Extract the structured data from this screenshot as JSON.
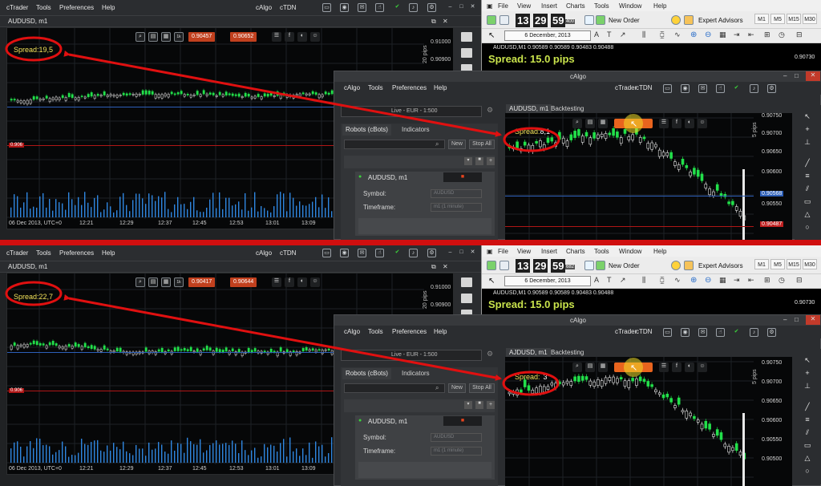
{
  "ctrader": {
    "menu": [
      "cTrader",
      "Tools",
      "Preferences",
      "Help"
    ],
    "right_menu": [
      "cAlgo",
      "cTDN"
    ],
    "symbol": "AUDUSD, m1",
    "price_ticks": [
      "0.91000",
      "0.90900"
    ],
    "time_ticks": [
      "06 Dec 2013, UTC+0",
      "12:21",
      "12:29",
      "12:37",
      "12:45",
      "12:53",
      "13:01",
      "13:09"
    ],
    "pips_label": "20 pips",
    "level_label": "0.906"
  },
  "panels": [
    {
      "spread_label": "Spread:",
      "spread_value": "19,5",
      "sell_price": "0.90457",
      "buy_price": "0.90652",
      "calgo_spread_label": "Spread:",
      "calgo_spread_value": "8,1"
    },
    {
      "spread_label": "Spread:",
      "spread_value": "22,7",
      "sell_price": "0.90417",
      "buy_price": "0.90644",
      "calgo_spread_label": "Spread:",
      "calgo_spread_value": "3"
    }
  ],
  "mt4": {
    "menu": [
      "File",
      "View",
      "Insert",
      "Charts",
      "Tools",
      "Window",
      "Help"
    ],
    "clock": {
      "h": "13",
      "m": "29",
      "s": "59"
    },
    "clock_badges": [
      "400",
      "682"
    ],
    "new_order": "New Order",
    "expert_advisors": "Expert Advisors",
    "timeframes": [
      "M1",
      "M5",
      "M15",
      "M30"
    ],
    "date": "6 December, 2013",
    "quote_line": "AUDUSD,M1 0.90589 0.90589 0.90483 0.90488",
    "quote_line_2": "AUDUSD,M1 0.90589 0.90589 0.90483 0.90488",
    "spread_text": "Spread: 15.0 pips",
    "price_right": "0.90730"
  },
  "calgo": {
    "title": "cAlgo",
    "menu": [
      "cAlgo",
      "Tools",
      "Preferences",
      "Help"
    ],
    "right_menu": [
      "cTrader",
      "cTDN"
    ],
    "account": "Live - EUR - 1:500",
    "tabs_left": [
      "Robots (cBots)",
      "Indicators"
    ],
    "new_label": "New",
    "stop_all_label": "Stop All",
    "instance": "AUDUSD, m1",
    "symbol_label": "Symbol:",
    "symbol_value": "AUDUSD",
    "timeframe_label": "Timeframe:",
    "timeframe_value": "m1 (1 minute)",
    "chart_tab": "AUDUSD, m1",
    "chart_tab_2": "AJDUSD, m1",
    "backtesting": "Backtesting",
    "price_ticks": [
      "0.90750",
      "0.90700",
      "0.90650",
      "0.90600",
      "0.90550",
      "0.90500"
    ],
    "blue_price": "0.90568",
    "red_price": "0.90487",
    "pips_label": "5 pips"
  },
  "colors": {
    "accent_red": "#e01010",
    "spread_yellow": "#f3e25a",
    "bull": "#22e04a",
    "bear": "#ffffff"
  }
}
